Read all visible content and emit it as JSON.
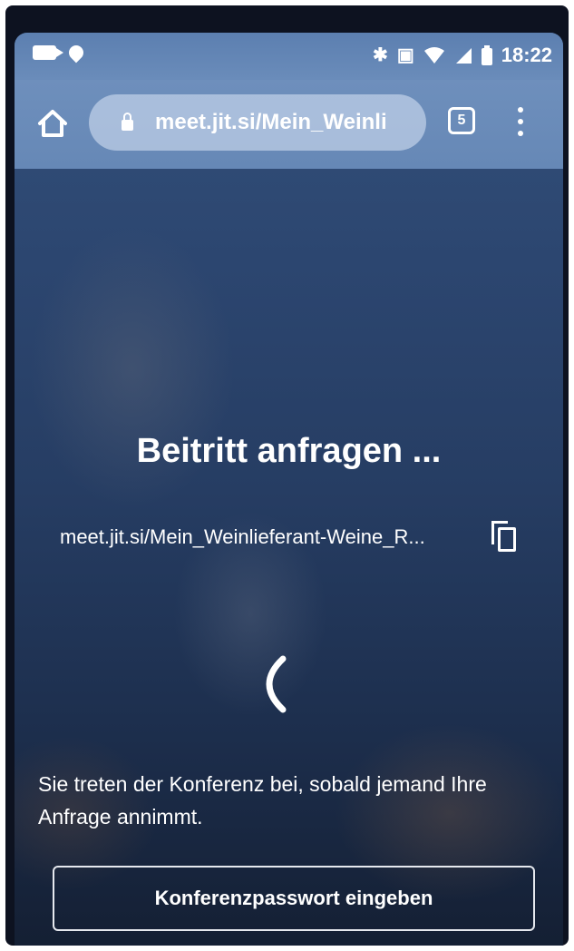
{
  "status_bar": {
    "time": "18:22",
    "left_icons": [
      "video-camera-icon",
      "location-pin-icon"
    ],
    "right_icons": [
      "bluetooth-icon",
      "vibrate-icon",
      "wifi-icon",
      "signal-icon",
      "battery-icon"
    ]
  },
  "browser": {
    "url": "meet.jit.si/Mein_Weinli",
    "tab_count": "5",
    "icons": [
      "home-icon",
      "lock-icon",
      "tabs-icon",
      "more-vert-icon"
    ]
  },
  "lobby": {
    "title": "Beitritt anfragen ...",
    "meeting_link": "meet.jit.si/Mein_Weinlieferant-Weine_R...",
    "message": "Sie treten der Konferenz bei, sobald jemand Ihre Anfrage annimmt.",
    "password_button_label": "Konferenzpasswort eingeben"
  },
  "colors": {
    "status_bar": "#5c7fb0",
    "toolbar": "#6e8fbc",
    "background_top": "#33507a",
    "background_bottom": "#141f33",
    "text": "#ffffff"
  }
}
